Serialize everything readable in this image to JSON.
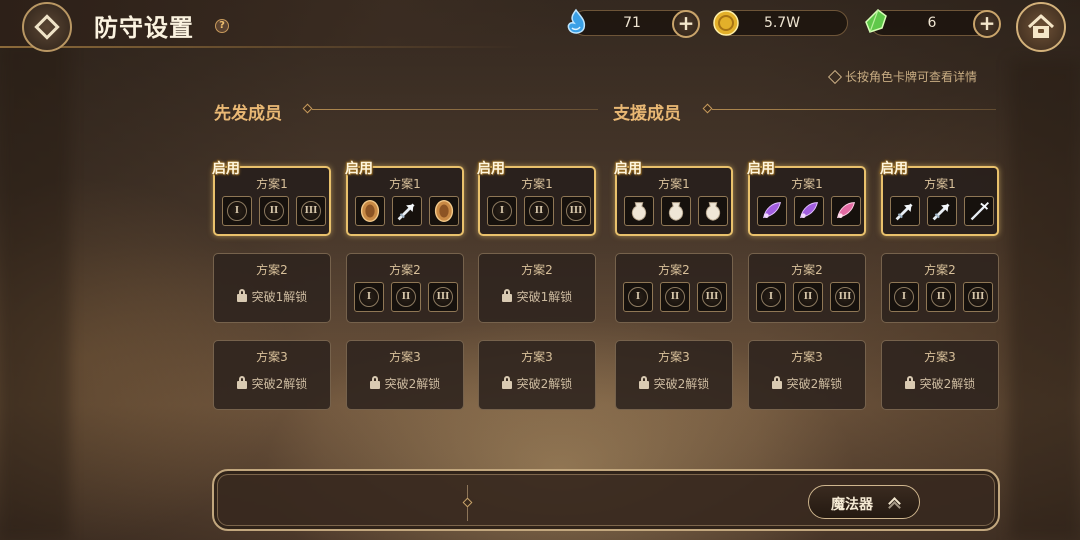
{
  "header": {
    "title": "防守设置",
    "help_icon": "question-icon"
  },
  "currencies": [
    {
      "icon": "water-drop-icon",
      "value": "71",
      "color": "#3aa0e6"
    },
    {
      "icon": "gold-coin-icon",
      "value": "5.7W",
      "color": "#e3b02a"
    },
    {
      "icon": "green-crystal-icon",
      "value": "6",
      "color": "#5fc84a"
    }
  ],
  "hint": "长按角色卡牌可查看详情",
  "sections": {
    "starter": "先发成员",
    "support": "支援成员"
  },
  "enabled_label": "启用",
  "slot_numerals": [
    "I",
    "II",
    "III"
  ],
  "columns": [
    {
      "plans": [
        {
          "label": "方案1",
          "active": true,
          "state": "slots",
          "items": [
            "",
            "",
            ""
          ]
        },
        {
          "label": "方案2",
          "state": "locked",
          "lock_text": "突破1解锁"
        },
        {
          "label": "方案3",
          "state": "locked",
          "lock_text": "突破2解锁"
        }
      ]
    },
    {
      "plans": [
        {
          "label": "方案1",
          "active": true,
          "state": "slots",
          "items": [
            "bronze-shield-icon",
            "silver-arrow-icon",
            "bronze-shield-icon"
          ]
        },
        {
          "label": "方案2",
          "state": "slots",
          "items": [
            "",
            "",
            ""
          ]
        },
        {
          "label": "方案3",
          "state": "locked",
          "lock_text": "突破2解锁"
        }
      ]
    },
    {
      "plans": [
        {
          "label": "方案1",
          "active": true,
          "state": "slots",
          "items": [
            "",
            "",
            ""
          ]
        },
        {
          "label": "方案2",
          "state": "locked",
          "lock_text": "突破1解锁"
        },
        {
          "label": "方案3",
          "state": "locked",
          "lock_text": "突破2解锁"
        }
      ]
    },
    {
      "plans": [
        {
          "label": "方案1",
          "active": true,
          "state": "slots",
          "items": [
            "white-vase-icon",
            "white-vase-icon",
            "white-vase-icon"
          ]
        },
        {
          "label": "方案2",
          "state": "slots",
          "items": [
            "",
            "",
            ""
          ]
        },
        {
          "label": "方案3",
          "state": "locked",
          "lock_text": "突破2解锁"
        }
      ]
    },
    {
      "plans": [
        {
          "label": "方案1",
          "active": true,
          "state": "slots",
          "items": [
            "purple-wing-icon",
            "purple-wing-icon",
            "pink-wing-icon"
          ]
        },
        {
          "label": "方案2",
          "state": "slots",
          "items": [
            "",
            "",
            ""
          ]
        },
        {
          "label": "方案3",
          "state": "locked",
          "lock_text": "突破2解锁"
        }
      ]
    },
    {
      "plans": [
        {
          "label": "方案1",
          "active": true,
          "state": "slots",
          "items": [
            "silver-arrow-icon",
            "silver-arrow-icon",
            "silver-trident-icon"
          ]
        },
        {
          "label": "方案2",
          "state": "slots",
          "items": [
            "",
            "",
            ""
          ]
        },
        {
          "label": "方案3",
          "state": "locked",
          "lock_text": "突破2解锁"
        }
      ]
    }
  ],
  "bottom_bar": {
    "magic_button": "魔法器",
    "expand_icon": "double-chevron-up-icon"
  }
}
